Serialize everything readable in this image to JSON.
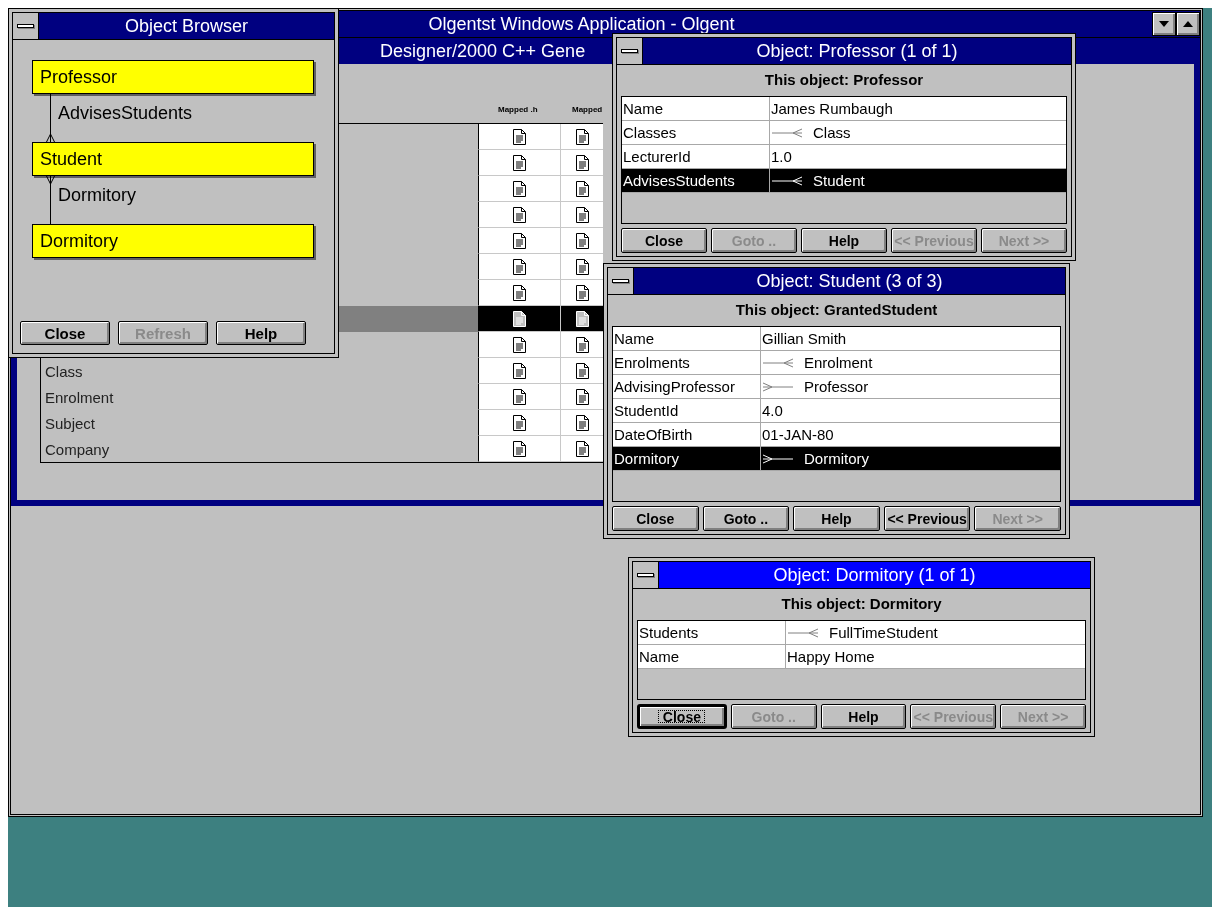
{
  "main_window": {
    "title": "Olgentst Windows Application - Olgent"
  },
  "designer_window": {
    "title": "Designer/2000 C++ Gene",
    "columns": [
      "Mapped .h",
      "Mapped"
    ],
    "rows": [
      {
        "selected": false
      },
      {
        "selected": false
      },
      {
        "selected": false
      },
      {
        "selected": false
      },
      {
        "selected": false
      },
      {
        "selected": false
      },
      {
        "selected": false
      },
      {
        "selected": true
      },
      {
        "selected": false
      },
      {
        "name": "Class",
        "selected": false
      },
      {
        "name": "Enrolment",
        "selected": false
      },
      {
        "name": "Subject",
        "selected": false
      },
      {
        "name": "Company",
        "selected": false
      }
    ]
  },
  "object_browser": {
    "title": "Object Browser",
    "active": false,
    "nodes": [
      {
        "label": "Professor",
        "link": {
          "label": "AdvisesStudents",
          "kind": "down"
        }
      },
      {
        "label": "Student",
        "link": {
          "label": "Dormitory",
          "kind": "up"
        }
      },
      {
        "label": "Dormitory"
      }
    ],
    "buttons": [
      {
        "label": "Close",
        "disabled": false
      },
      {
        "label": "Refresh",
        "disabled": true
      },
      {
        "label": "Help",
        "disabled": false
      }
    ]
  },
  "object_windows": [
    {
      "title": "Object: Professor (1 of 1)",
      "active": false,
      "heading": "This object: Professor",
      "rows": [
        {
          "kind": "value",
          "attribute": "Name",
          "value": "James Rumbaugh",
          "selected": false
        },
        {
          "kind": "many",
          "attribute": "Classes",
          "value": "Class",
          "selected": false
        },
        {
          "kind": "value",
          "attribute": "LecturerId",
          "value": "1.0",
          "selected": false
        },
        {
          "kind": "many",
          "attribute": "AdvisesStudents",
          "value": "Student",
          "selected": true
        }
      ],
      "buttons": [
        {
          "label": "Close",
          "disabled": false,
          "focused": false
        },
        {
          "label": "Goto ..",
          "disabled": true,
          "focused": false
        },
        {
          "label": "Help",
          "disabled": false,
          "focused": false
        },
        {
          "label": "<< Previous",
          "disabled": true,
          "focused": false
        },
        {
          "label": "Next >>",
          "disabled": true,
          "focused": false
        }
      ]
    },
    {
      "title": "Object: Student (3 of 3)",
      "active": false,
      "heading": "This object: GrantedStudent",
      "rows": [
        {
          "kind": "value",
          "attribute": "Name",
          "value": "Gillian Smith",
          "selected": false
        },
        {
          "kind": "many",
          "attribute": "Enrolments",
          "value": "Enrolment",
          "selected": false
        },
        {
          "kind": "one",
          "attribute": "AdvisingProfessor",
          "value": "Professor",
          "selected": false
        },
        {
          "kind": "value",
          "attribute": "StudentId",
          "value": "4.0",
          "selected": false
        },
        {
          "kind": "value",
          "attribute": "DateOfBirth",
          "value": "01-JAN-80",
          "selected": false
        },
        {
          "kind": "one",
          "attribute": "Dormitory",
          "value": "Dormitory",
          "selected": true
        }
      ],
      "buttons": [
        {
          "label": "Close",
          "disabled": false,
          "focused": false
        },
        {
          "label": "Goto ..",
          "disabled": false,
          "focused": false
        },
        {
          "label": "Help",
          "disabled": false,
          "focused": false
        },
        {
          "label": "<< Previous",
          "disabled": false,
          "focused": false
        },
        {
          "label": "Next >>",
          "disabled": true,
          "focused": false
        }
      ]
    },
    {
      "title": "Object: Dormitory (1 of 1)",
      "active": true,
      "heading": "This object: Dormitory",
      "rows": [
        {
          "kind": "many",
          "attribute": "Students",
          "value": "FullTimeStudent",
          "selected": false
        },
        {
          "kind": "value",
          "attribute": "Name",
          "value": "Happy Home",
          "selected": false
        }
      ],
      "buttons": [
        {
          "label": "Close",
          "disabled": false,
          "focused": true
        },
        {
          "label": "Goto ..",
          "disabled": true,
          "focused": false
        },
        {
          "label": "Help",
          "disabled": false,
          "focused": false
        },
        {
          "label": "<< Previous",
          "disabled": true,
          "focused": false
        },
        {
          "label": "Next >>",
          "disabled": true,
          "focused": false
        }
      ]
    }
  ]
}
